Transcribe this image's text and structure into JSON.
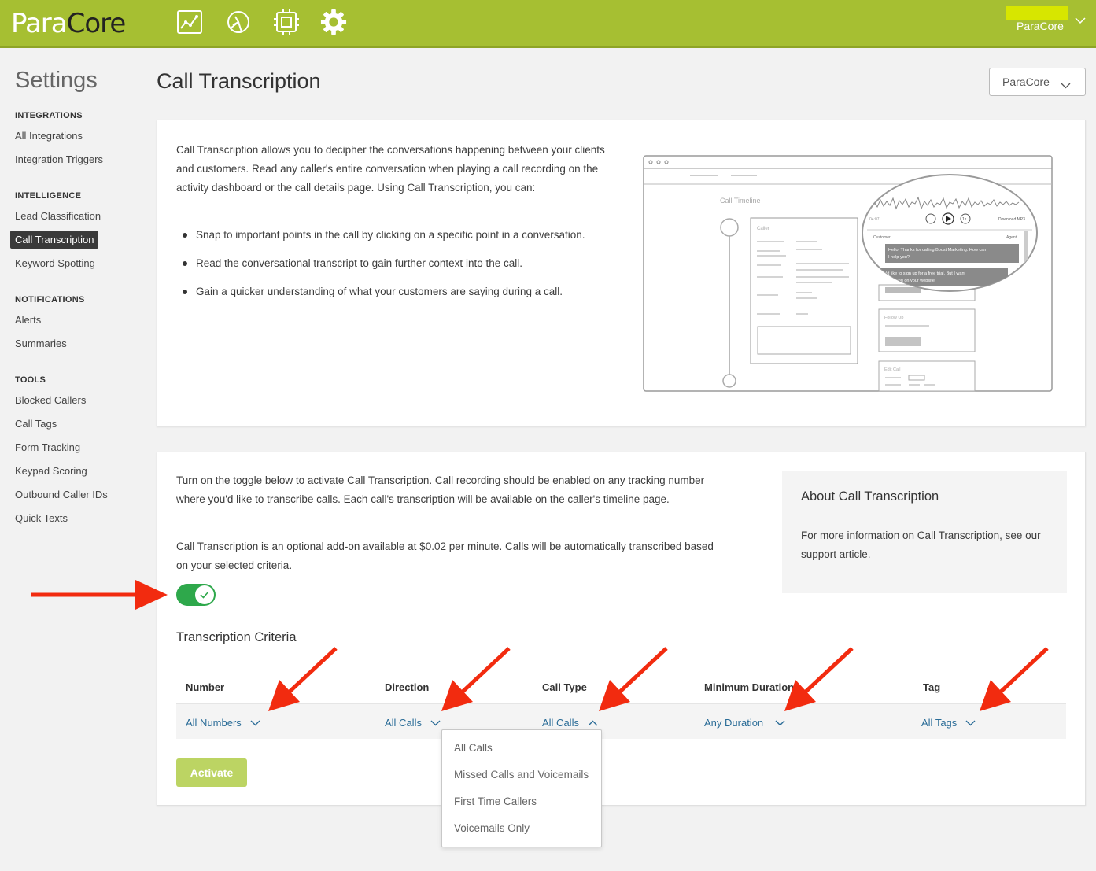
{
  "header": {
    "logo_part1": "Para",
    "logo_part2": "Core",
    "nav_icons": [
      "analytics-icon",
      "chart-pie-icon",
      "integrations-chip-icon",
      "settings-gear-icon"
    ],
    "user_name": "ParaCore"
  },
  "sidebar": {
    "title": "Settings",
    "sections": [
      {
        "label": "INTEGRATIONS",
        "items": [
          "All Integrations",
          "Integration Triggers"
        ]
      },
      {
        "label": "INTELLIGENCE",
        "items": [
          "Lead Classification",
          "Call Transcription",
          "Keyword Spotting"
        ]
      },
      {
        "label": "NOTIFICATIONS",
        "items": [
          "Alerts",
          "Summaries"
        ]
      },
      {
        "label": "TOOLS",
        "items": [
          "Blocked Callers",
          "Call Tags",
          "Form Tracking",
          "Keypad Scoring",
          "Outbound Caller IDs",
          "Quick Texts"
        ]
      }
    ],
    "active_item": "Call Transcription"
  },
  "page": {
    "title": "Call Transcription",
    "account_select": "ParaCore"
  },
  "intro": {
    "text": "Call Transcription allows you to decipher the conversations happening between your clients and customers. Read any caller's entire conversation when playing a call recording on the activity dashboard or the call details page. Using Call Transcription, you can:",
    "bullets": [
      "Snap to important points in the call by clicking on a specific point in a conversation.",
      "Read the conversational transcript to gain further context into the call.",
      "Gain a quicker understanding of what your customers are saying during a call."
    ]
  },
  "illustration": {
    "timeline_label": "Call Timeline",
    "caller_label": "Caller",
    "follow_up_label": "Follow Up",
    "edit_call_label": "Edit Call",
    "time": "04:07",
    "speed": "1x",
    "download": "Download MP3",
    "customer_label": "Customer",
    "agent_label": "Agent",
    "bubble1": "Hello. Thanks for calling Boost Marketing. How can I help you?",
    "bubble2": "I would like to sign up for a free trial. But I want special pricing on your website."
  },
  "activation": {
    "para1": "Turn on the toggle below to activate Call Transcription. Call recording should be enabled on any tracking number where you'd like to transcribe calls. Each call's transcription will be available on the caller's timeline page.",
    "para2": "Call Transcription is an optional add-on available at $0.02 per minute. Calls will be automatically transcribed based on your selected criteria.",
    "toggle_on": true,
    "about_title": "About Call Transcription",
    "about_text": "For more information on Call Transcription, see our support article."
  },
  "criteria": {
    "title": "Transcription Criteria",
    "columns": [
      {
        "header": "Number",
        "value": "All Numbers"
      },
      {
        "header": "Direction",
        "value": "All Calls"
      },
      {
        "header": "Call Type",
        "value": "All Calls"
      },
      {
        "header": "Minimum Duration",
        "value": "Any Duration"
      },
      {
        "header": "Tag",
        "value": "All Tags"
      }
    ],
    "activate_label": "Activate",
    "call_type_options": [
      "All Calls",
      "Missed Calls and Voicemails",
      "First Time Callers",
      "Voicemails Only"
    ]
  },
  "colors": {
    "brand_green": "#a6bf32",
    "toggle_green": "#2ea84b",
    "link_blue": "#2a6c97",
    "annotation_red": "#f22b0f",
    "activate_bg": "#bcd463"
  }
}
